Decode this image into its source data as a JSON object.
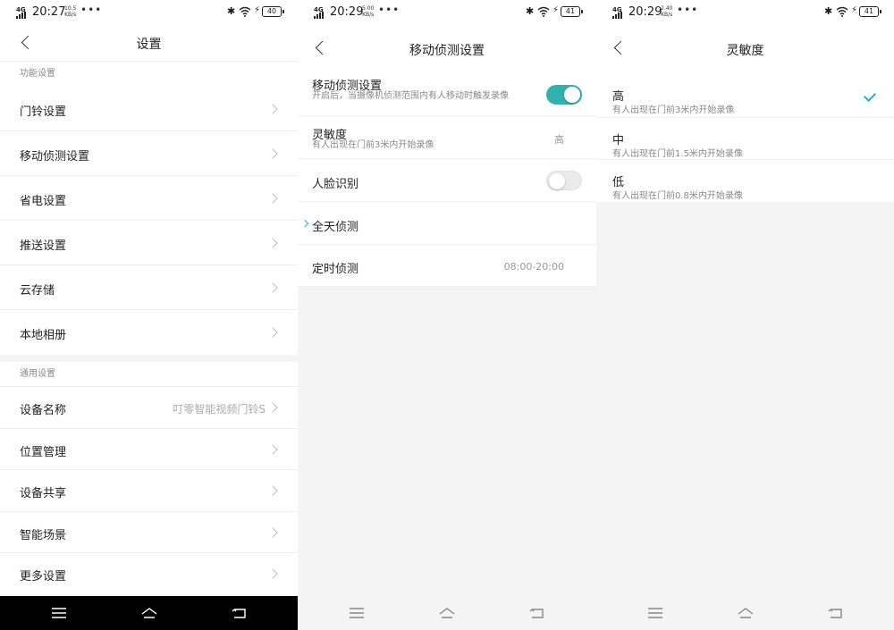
{
  "screens": [
    {
      "status": {
        "network": "4G",
        "time": "20:27",
        "speed": "10.5",
        "speed_unit": "KB/s",
        "dots": "•••",
        "battery": "40"
      },
      "title": "设置",
      "section1_label": "功能设置",
      "items1": [
        {
          "label": "门铃设置"
        },
        {
          "label": "移动侦测设置"
        },
        {
          "label": "省电设置"
        },
        {
          "label": "推送设置"
        },
        {
          "label": "云存储"
        },
        {
          "label": "本地相册"
        }
      ],
      "section2_label": "通用设置",
      "items2": [
        {
          "label": "设备名称",
          "value": "叮零智能视频门铃S"
        },
        {
          "label": "位置管理"
        },
        {
          "label": "设备共享"
        },
        {
          "label": "智能场景"
        },
        {
          "label": "更多设置"
        }
      ]
    },
    {
      "status": {
        "network": "4G",
        "time": "20:29",
        "speed": "5.00",
        "speed_unit": "KB/s",
        "dots": "•••",
        "battery": "41"
      },
      "title": "移动侦测设置",
      "motion": {
        "label": "移动侦测设置",
        "desc": "开启后，当摄像机侦测范围内有人移动时触发录像",
        "enabled": true
      },
      "sensitivity": {
        "label": "灵敏度",
        "desc": "有人出现在门前3米内开始录像",
        "value": "高"
      },
      "face": {
        "label": "人脸识别",
        "enabled": false
      },
      "allday": {
        "label": "全天侦测"
      },
      "scheduled": {
        "label": "定时侦测",
        "value": "08:00-20:00"
      }
    },
    {
      "status": {
        "network": "4G",
        "time": "20:29",
        "speed": "2.40",
        "speed_unit": "KB/s",
        "dots": "•••",
        "battery": "41"
      },
      "title": "灵敏度",
      "options": [
        {
          "label": "高",
          "desc": "有人出现在门前3米内开始录像",
          "selected": true
        },
        {
          "label": "中",
          "desc": "有人出现在门前1.5米内开始录像",
          "selected": false
        },
        {
          "label": "低",
          "desc": "有人出现在门前0.8米内开始录像",
          "selected": false
        }
      ]
    }
  ],
  "colors": {
    "accent": "#2fb2ad",
    "background": "#f4f4f4"
  }
}
